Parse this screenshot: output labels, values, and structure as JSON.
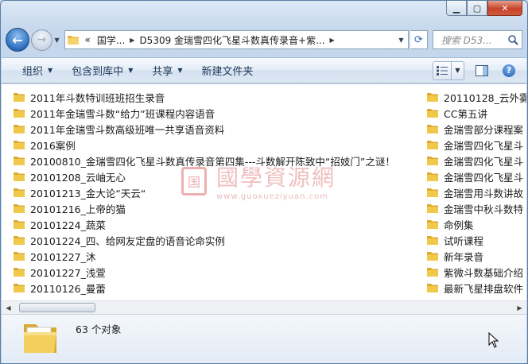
{
  "window": {
    "caption": {
      "minimize": "▁",
      "maximize": "▢",
      "close": "✕"
    }
  },
  "nav": {
    "back_glyph": "←",
    "forward_glyph": "→",
    "breadcrumbs": [
      "«",
      "国学...",
      "D5309 金瑞雪四化飞星斗数真传录音+紫..."
    ],
    "refresh_glyph": "⟳",
    "search_placeholder": "搜索 D53..."
  },
  "toolbar": {
    "organize": "组织",
    "include_in_library": "包含到库中",
    "share": "共享",
    "new_folder": "新建文件夹",
    "help": "?"
  },
  "files_left": [
    "2011年斗数特训班班招生录音",
    "2011年金瑞雪斗数“给力”班课程内容语音",
    "2011年金瑞雪斗数高级班唯一共享语音资料",
    "2016案例",
    "20100810_金瑞雪四化飞星斗数真传录音第四集---斗数解开陈致中“招妓门”之谜！",
    "20101208_云岫无心",
    "20101213_金大论“天云“",
    "20101216_上帝的猫",
    "20101224_蔬菜",
    "20101224_四、给网友定盘的语音论命实例",
    "20101227_沐",
    "20101227_浅萱",
    "20110126_曼蕾"
  ],
  "files_right": [
    "20110128_云外雾",
    "CC第五讲",
    "金瑞雪部分课程案",
    "金瑞雪四化飞星斗",
    "金瑞雪四化飞星斗",
    "金瑞雪四化飞星斗",
    "金瑞雪用斗数讲故",
    "金瑞雪中秋斗数特",
    "命例集",
    "试听课程",
    "新年录音",
    "紫微斗数基础介绍",
    "最新飞星排盘软件"
  ],
  "watermark": {
    "seal": "国",
    "text": "國學資源網",
    "url": "www.guoxueziyuan.com"
  },
  "status": {
    "object_count": "63 个对象"
  },
  "colors": {
    "folder": "#f0c94a",
    "accent": "#2a6cc0",
    "toolbar_text": "#1e395b"
  }
}
